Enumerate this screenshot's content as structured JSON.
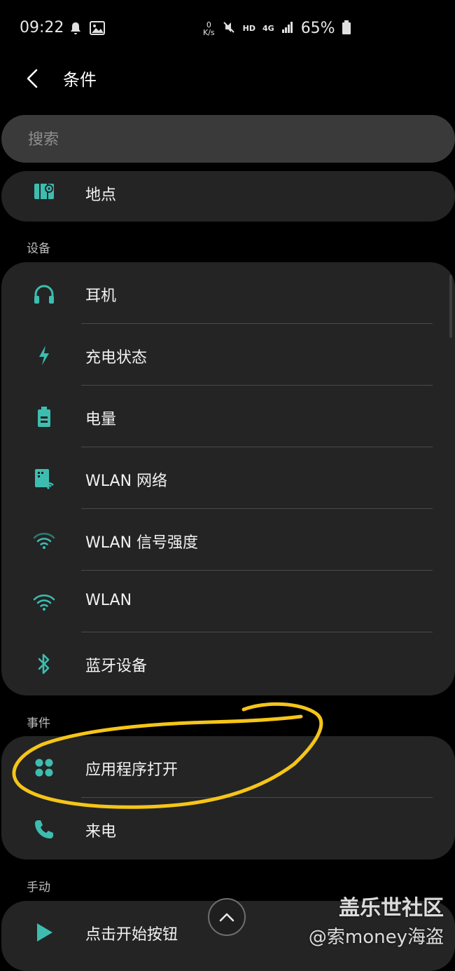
{
  "status_bar": {
    "time": "09:22",
    "net_speed_value": "0",
    "net_speed_unit": "K/s",
    "hd": "HD",
    "network": "4G",
    "battery": "65%"
  },
  "header": {
    "title": "条件"
  },
  "search": {
    "placeholder": "搜索"
  },
  "location_card": {
    "items": [
      {
        "label": "地点",
        "icon": "map-pin-icon"
      }
    ]
  },
  "sections": {
    "device": {
      "title": "设备",
      "items": [
        {
          "label": "耳机",
          "icon": "headphones-icon"
        },
        {
          "label": "充电状态",
          "icon": "lightning-icon"
        },
        {
          "label": "电量",
          "icon": "battery-icon"
        },
        {
          "label": "WLAN 网络",
          "icon": "wlan-network-icon"
        },
        {
          "label": "WLAN 信号强度",
          "icon": "wifi-signal-icon"
        },
        {
          "label": "WLAN",
          "icon": "wifi-icon"
        },
        {
          "label": "蓝牙设备",
          "icon": "bluetooth-icon"
        }
      ]
    },
    "event": {
      "title": "事件",
      "items": [
        {
          "label": "应用程序打开",
          "icon": "apps-icon"
        },
        {
          "label": "来电",
          "icon": "phone-icon"
        }
      ]
    },
    "manual": {
      "title": "手动",
      "items": [
        {
          "label": "点击开始按钮",
          "icon": "play-icon"
        }
      ]
    }
  },
  "watermark": {
    "title": "盖乐世社区",
    "credit": "@索money海盗"
  },
  "colors": {
    "background": "#000000",
    "card": "#242424",
    "search": "#3a3a3a",
    "accent_teal": "#3dbdb0",
    "annotation_yellow": "#f5c518"
  }
}
